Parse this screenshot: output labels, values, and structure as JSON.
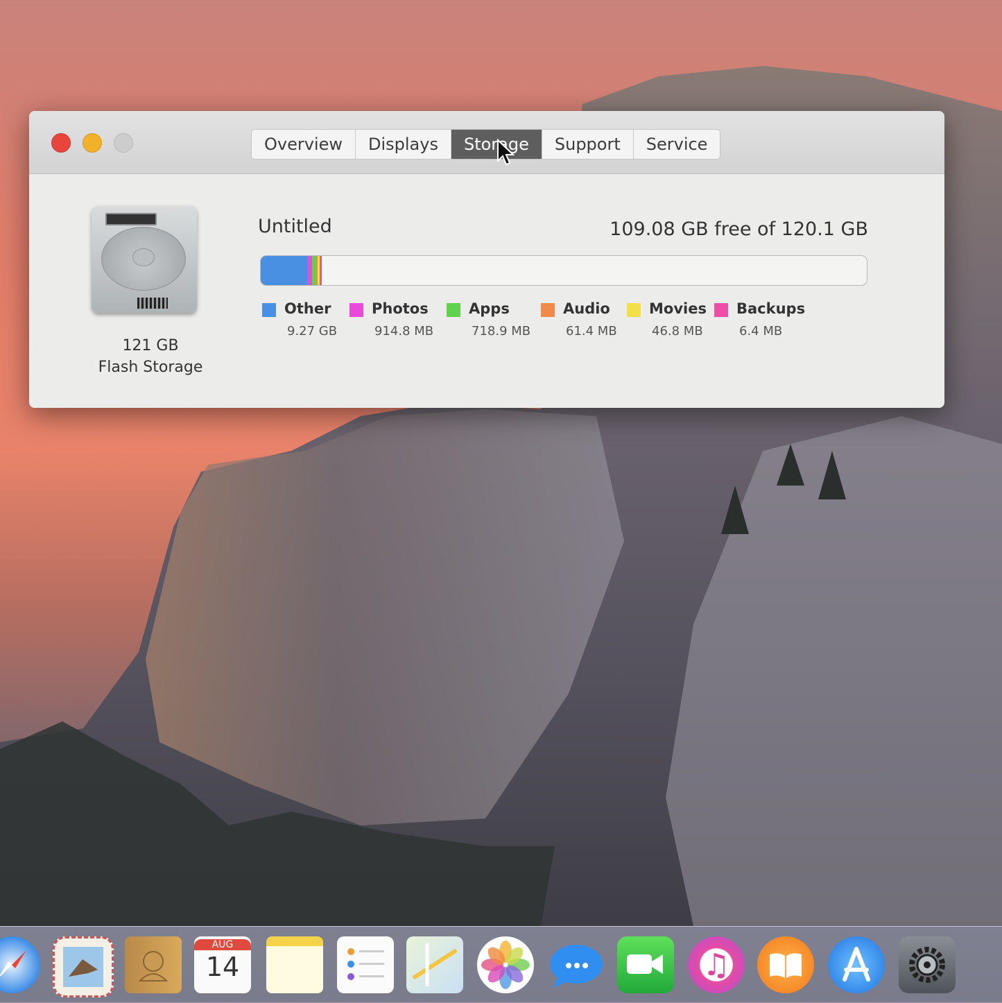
{
  "window": {
    "tabs": [
      {
        "label": "Overview",
        "active": false
      },
      {
        "label": "Displays",
        "active": false
      },
      {
        "label": "Storage",
        "active": true
      },
      {
        "label": "Support",
        "active": false
      },
      {
        "label": "Service",
        "active": false
      }
    ]
  },
  "storage": {
    "capacity_line1": "121 GB",
    "capacity_line2": "Flash Storage",
    "volume_name": "Untitled",
    "free_text": "109.08 GB free of 120.1 GB",
    "usage_fraction": {
      "other": 0.0772,
      "photos": 0.0076,
      "apps": 0.006,
      "audio": 0.0005,
      "movies": 0.0004,
      "backups": 0.0001
    },
    "legend": [
      {
        "key": "other",
        "name": "Other",
        "size": "9.27 GB",
        "color": "#4a90e2"
      },
      {
        "key": "photos",
        "name": "Photos",
        "size": "914.8 MB",
        "color": "#e84bd8"
      },
      {
        "key": "apps",
        "name": "Apps",
        "size": "718.9 MB",
        "color": "#5fd14f"
      },
      {
        "key": "audio",
        "name": "Audio",
        "size": "61.4 MB",
        "color": "#f08a4b"
      },
      {
        "key": "movies",
        "name": "Movies",
        "size": "46.8 MB",
        "color": "#f2e04a"
      },
      {
        "key": "backups",
        "name": "Backups",
        "size": "6.4 MB",
        "color": "#ec4fa6"
      }
    ]
  },
  "dock": {
    "calendar_month": "AUG",
    "calendar_day": "14",
    "icons": [
      "safari-icon",
      "mail-icon",
      "contacts-icon",
      "calendar-icon",
      "notes-icon",
      "reminders-icon",
      "maps-icon",
      "photos-icon",
      "messages-icon",
      "facetime-icon",
      "itunes-icon",
      "ibooks-icon",
      "app-store-icon",
      "system-preferences-icon"
    ]
  }
}
